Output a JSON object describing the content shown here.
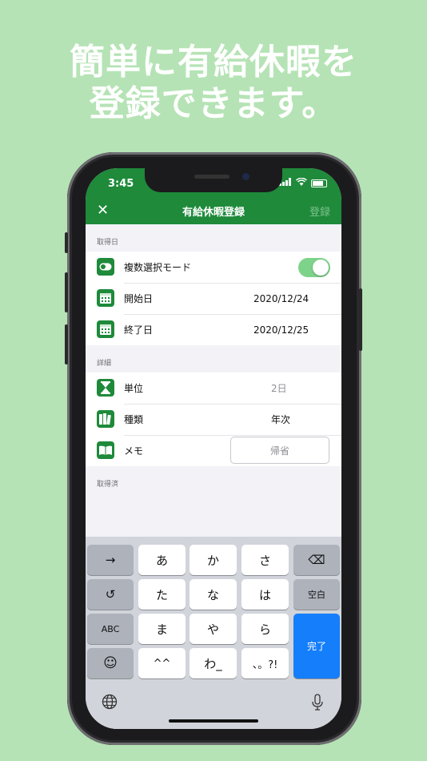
{
  "promo": {
    "line1": "簡単に有給休暇を",
    "line2": "登録できます。"
  },
  "status": {
    "time": "3:45"
  },
  "navbar": {
    "close": "✕",
    "title": "有給休暇登録",
    "action": "登録"
  },
  "sections": {
    "date": {
      "header": "取得日",
      "multi_select_label": "複数選択モード",
      "multi_select_on": true,
      "start_label": "開始日",
      "start_value": "2020/12/24",
      "end_label": "終了日",
      "end_value": "2020/12/25"
    },
    "detail": {
      "header": "詳細",
      "unit_label": "単位",
      "unit_value": "2日",
      "type_label": "種類",
      "type_value": "年次",
      "memo_label": "メモ",
      "memo_value": "帰省"
    },
    "taken": {
      "header": "取得済"
    }
  },
  "keyboard": {
    "arrow": "→",
    "a": "あ",
    "ka": "か",
    "sa": "さ",
    "backspace": "⌫",
    "undo": "↺",
    "ta": "た",
    "na": "な",
    "ha": "は",
    "space": "空白",
    "abc": "ABC",
    "ma": "ま",
    "ya": "や",
    "ra": "ら",
    "done": "完了",
    "emoji": "☺",
    "small": "^^",
    "wa": "わ_",
    "punct": "、。?!",
    "globe": "⊕",
    "mic": "🎙"
  },
  "colors": {
    "accent": "#1e8a3a",
    "background": "#b5e3b5",
    "toggle": "#7ed38b",
    "done": "#147efb"
  }
}
